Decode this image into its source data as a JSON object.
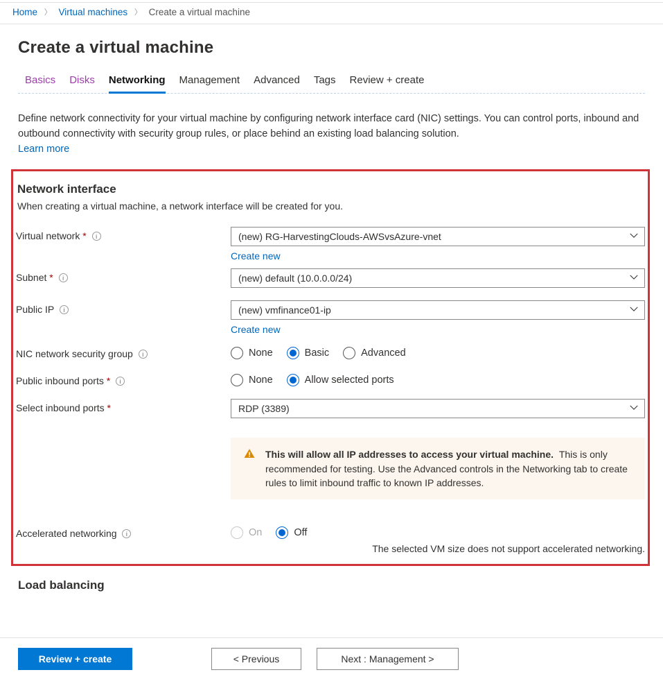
{
  "breadcrumb": {
    "home": "Home",
    "vms": "Virtual machines",
    "current": "Create a virtual machine"
  },
  "page_title": "Create a virtual machine",
  "tabs": [
    "Basics",
    "Disks",
    "Networking",
    "Management",
    "Advanced",
    "Tags",
    "Review + create"
  ],
  "active_tab": "Networking",
  "intro_text": "Define network connectivity for your virtual machine by configuring network interface card (NIC) settings. You can control ports, inbound and outbound connectivity with security group rules, or place behind an existing load balancing solution.",
  "learn_more": "Learn more",
  "section": {
    "title": "Network interface",
    "subtitle": "When creating a virtual machine, a network interface will be created for you."
  },
  "fields": {
    "vnet": {
      "label": "Virtual network",
      "value": "(new) RG-HarvestingClouds-AWSvsAzure-vnet",
      "create_new": "Create new"
    },
    "subnet": {
      "label": "Subnet",
      "value": "(new) default (10.0.0.0/24)"
    },
    "public_ip": {
      "label": "Public IP",
      "value": "(new) vmfinance01-ip",
      "create_new": "Create new"
    },
    "nsg": {
      "label": "NIC network security group",
      "options": [
        "None",
        "Basic",
        "Advanced"
      ],
      "selected": "Basic"
    },
    "ports": {
      "label": "Public inbound ports",
      "options": [
        "None",
        "Allow selected ports"
      ],
      "selected": "Allow selected ports"
    },
    "inbound": {
      "label": "Select inbound ports",
      "value": "RDP (3389)"
    },
    "accel": {
      "label": "Accelerated networking",
      "options": [
        "On",
        "Off"
      ],
      "selected": "Off",
      "hint": "The selected VM size does not support accelerated networking."
    }
  },
  "warning": {
    "bold": "This will allow all IP addresses to access your virtual machine.",
    "rest": "This is only recommended for testing.  Use the Advanced controls in the Networking tab to create rules to limit inbound traffic to known IP addresses."
  },
  "load_balancing": "Load balancing",
  "footer": {
    "review": "Review + create",
    "previous": "< Previous",
    "next": "Next : Management >"
  }
}
